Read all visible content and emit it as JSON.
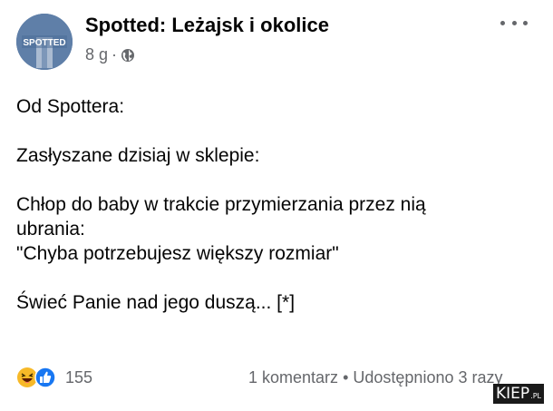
{
  "post": {
    "page_name": "Spotted: Leżajsk i okolice",
    "avatar_text": "SPOTTED",
    "time": "8 g",
    "separator": "·",
    "icons": {
      "visibility": "globe-icon",
      "menu": "more-icon"
    },
    "paragraphs": [
      "Od Spottera:",
      "Zasłyszane dzisiaj w sklepie:",
      "Chłop do baby w trakcie przymierzania przez nią\nubrania:\n\"Chyba potrzebujesz większy rozmiar\"",
      "Świeć Panie nad jego duszą... [*]"
    ]
  },
  "footer": {
    "reaction_icons": [
      "haha-icon",
      "like-icon"
    ],
    "reaction_count": "155",
    "comments": "1 komentarz",
    "dot": "•",
    "shares": "Udostępniono 3 razy"
  },
  "watermark": {
    "text": "KIEP",
    "suffix": ".PL"
  },
  "colors": {
    "text": "#050505",
    "muted": "#65676b",
    "like": "#1877f2",
    "haha": "#f7b928"
  }
}
